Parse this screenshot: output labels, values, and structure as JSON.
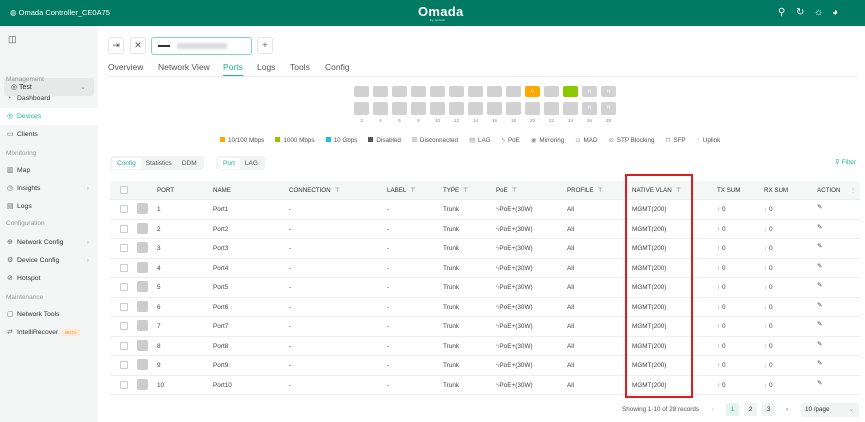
{
  "header": {
    "title": "Omada Controller_CE0A75",
    "logo": "Omada",
    "logo_sub": "by tp-link"
  },
  "sidebar": {
    "site": "Test",
    "sections": [
      "Management",
      "Monitoring",
      "Configuration",
      "Maintenance"
    ],
    "items": [
      {
        "label": "Dashboard",
        "icon": "dashboard-icon"
      },
      {
        "label": "Devices",
        "icon": "devices-icon",
        "active": true
      },
      {
        "label": "Clients",
        "icon": "clients-icon"
      },
      {
        "label": "Map",
        "icon": "map-icon"
      },
      {
        "label": "Insights",
        "icon": "insights-icon"
      },
      {
        "label": "Logs",
        "icon": "logs-icon"
      },
      {
        "label": "Network Config",
        "icon": "globe-icon"
      },
      {
        "label": "Device Config",
        "icon": "device-config-icon"
      },
      {
        "label": "Hotspot",
        "icon": "hotspot-icon"
      },
      {
        "label": "Network Tools",
        "icon": "toolbox-icon"
      },
      {
        "label": "IntelliRecover",
        "icon": "recover-icon",
        "badge": "BETA"
      }
    ]
  },
  "tabs": [
    "Overview",
    "Network View",
    "Ports",
    "Logs",
    "Tools",
    "Config"
  ],
  "active_tab": "Ports",
  "port_labels": [
    "2",
    "4",
    "6",
    "8",
    "10",
    "12",
    "14",
    "16",
    "18",
    "20",
    "22",
    "24",
    "26",
    "28"
  ],
  "legend": [
    "10/100 Mbps",
    "1000 Mbps",
    "10 Gbps",
    "Disabled",
    "Disconnected",
    "LAG",
    "PoE",
    "Mirroring",
    "MAD",
    "STP Blocking",
    "SFP",
    "Uplink"
  ],
  "colors": {
    "accent": "#1eb394",
    "header": "#007a63",
    "speed_100": "#ffa800",
    "speed_1000": "#8cc800",
    "speed_10g": "#1ec0d6",
    "disabled": "#555555",
    "disconnected": "#d2d2d2",
    "highlight": "#e01b1b"
  },
  "view_tabs": [
    "Config",
    "Statistics",
    "DDM"
  ],
  "type_tabs": [
    "Port",
    "LAG"
  ],
  "filter": "Filter",
  "columns": [
    "PORT",
    "NAME",
    "CONNECTION",
    "LABEL",
    "TYPE",
    "PoE",
    "PROFILE",
    "NATIVE VLAN",
    "TX SUM",
    "RX SUM",
    "ACTION"
  ],
  "rows": [
    {
      "port": "1",
      "name": "Port1",
      "connection": "-",
      "label": "-",
      "type": "Trunk",
      "poe": "PoE+(30W)",
      "profile": "All",
      "vlan": "MGMT(200)",
      "tx": "0",
      "rx": "0"
    },
    {
      "port": "2",
      "name": "Port2",
      "connection": "-",
      "label": "-",
      "type": "Trunk",
      "poe": "PoE+(30W)",
      "profile": "All",
      "vlan": "MGMT(200)",
      "tx": "0",
      "rx": "0"
    },
    {
      "port": "3",
      "name": "Port3",
      "connection": "-",
      "label": "-",
      "type": "Trunk",
      "poe": "PoE+(30W)",
      "profile": "All",
      "vlan": "MGMT(200)",
      "tx": "0",
      "rx": "0"
    },
    {
      "port": "4",
      "name": "Port4",
      "connection": "-",
      "label": "-",
      "type": "Trunk",
      "poe": "PoE+(30W)",
      "profile": "All",
      "vlan": "MGMT(200)",
      "tx": "0",
      "rx": "0"
    },
    {
      "port": "5",
      "name": "Port5",
      "connection": "-",
      "label": "-",
      "type": "Trunk",
      "poe": "PoE+(30W)",
      "profile": "All",
      "vlan": "MGMT(200)",
      "tx": "0",
      "rx": "0"
    },
    {
      "port": "6",
      "name": "Port6",
      "connection": "-",
      "label": "-",
      "type": "Trunk",
      "poe": "PoE+(30W)",
      "profile": "All",
      "vlan": "MGMT(200)",
      "tx": "0",
      "rx": "0"
    },
    {
      "port": "7",
      "name": "Port7",
      "connection": "-",
      "label": "-",
      "type": "Trunk",
      "poe": "PoE+(30W)",
      "profile": "All",
      "vlan": "MGMT(200)",
      "tx": "0",
      "rx": "0"
    },
    {
      "port": "8",
      "name": "Port8",
      "connection": "-",
      "label": "-",
      "type": "Trunk",
      "poe": "PoE+(30W)",
      "profile": "All",
      "vlan": "MGMT(200)",
      "tx": "0",
      "rx": "0"
    },
    {
      "port": "9",
      "name": "Port9",
      "connection": "-",
      "label": "-",
      "type": "Trunk",
      "poe": "PoE+(30W)",
      "profile": "All",
      "vlan": "MGMT(200)",
      "tx": "0",
      "rx": "0"
    },
    {
      "port": "10",
      "name": "Port10",
      "connection": "-",
      "label": "-",
      "type": "Trunk",
      "poe": "PoE+(30W)",
      "profile": "All",
      "vlan": "MGMT(200)",
      "tx": "0",
      "rx": "0"
    }
  ],
  "pagination": {
    "summary": "Showing 1-10 of 28 records",
    "pages": [
      "1",
      "2",
      "3"
    ],
    "current": "1",
    "page_size": "10 /page"
  }
}
